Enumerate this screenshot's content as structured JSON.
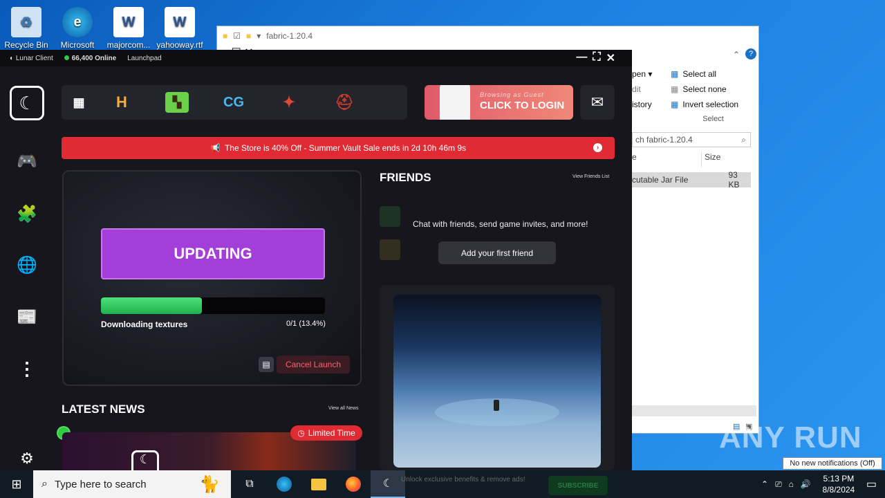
{
  "desktop": {
    "icons": [
      {
        "label": "Recycle Bin",
        "icon": "recycle-bin-icon"
      },
      {
        "label": "Microsoft",
        "icon": "edge-icon"
      },
      {
        "label": "majorcom...",
        "icon": "word-doc-icon"
      },
      {
        "label": "yahooway.rtf",
        "icon": "word-doc-icon"
      }
    ]
  },
  "explorer": {
    "title": "fabric-1.20.4",
    "ribbon": {
      "open": "pen ▾",
      "edit": "dit",
      "history": "istory",
      "select_all": "Select all",
      "select_none": "Select none",
      "invert_selection": "Invert selection",
      "group_label": "Select"
    },
    "search_placeholder": "ch fabric-1.20.4",
    "columns": {
      "col1": "e",
      "size": "Size"
    },
    "row": {
      "type": "cutable Jar File",
      "size": "93 KB"
    }
  },
  "lunar": {
    "app_name": "Lunar Client",
    "online_count": "66,400 Online",
    "launchpad": "Launchpad",
    "login": {
      "small": "Browsing as Guest",
      "big": "CLICK TO LOGIN"
    },
    "banner": "The Store is 40% Off - Summer Vault Sale ends in 2d 10h 46m 9s",
    "update_label": "UPDATING",
    "progress": {
      "label": "Downloading textures",
      "value": "0/1 (13.4%)",
      "fraction": 0.45
    },
    "cancel_label": "Cancel Launch",
    "friends": {
      "title": "FRIENDS",
      "view_link": "View Friends List",
      "message": "Chat with friends, send game invites, and more!",
      "add_button": "Add your first friend"
    },
    "news": {
      "title": "LATEST NEWS",
      "view_link": "View all News",
      "badge": "Limited Time"
    },
    "subscribe_text": "Unlock exclusive benefits & remove ads!",
    "subscribe_button": "SUBSCRIBE"
  },
  "taskbar": {
    "search_placeholder": "Type here to search",
    "time": "5:13 PM",
    "date": "8/8/2024",
    "notification_tip": "No new notifications (Off)"
  },
  "watermark": "ANY RUN"
}
